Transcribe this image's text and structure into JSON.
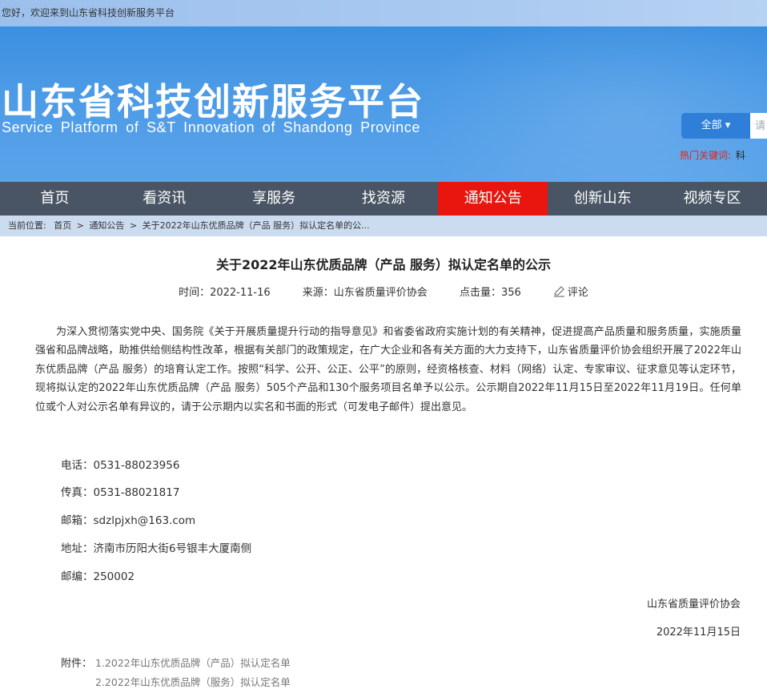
{
  "topbar": {
    "welcome": "您好，欢迎来到山东省科技创新服务平台"
  },
  "header": {
    "title": "山东省科技创新服务平台",
    "subtitle": "Service Platform of S&T Innovation of Shandong Province",
    "search": {
      "category": "全部 ▾",
      "placeholder": "请"
    },
    "hot_keywords": {
      "label": "热门关键词:",
      "first": "科"
    }
  },
  "nav": {
    "items": [
      {
        "label": "首页"
      },
      {
        "label": "看资讯"
      },
      {
        "label": "享服务"
      },
      {
        "label": "找资源"
      },
      {
        "label": "通知公告"
      },
      {
        "label": "创新山东"
      },
      {
        "label": "视频专区"
      }
    ],
    "active": "通知公告"
  },
  "breadcrumb": {
    "prefix": "当前位置:",
    "home": "首页",
    "section": "通知公告",
    "current": "关于2022年山东优质品牌（产品 服务）拟认定名单的公..."
  },
  "article": {
    "title": "关于2022年山东优质品牌（产品 服务）拟认定名单的公示",
    "time": "时间：2022-11-16",
    "source": "来源：山东省质量评价协会",
    "clicks": "点击量：356",
    "comment": "评论",
    "body": "为深入贯彻落实党中央、国务院《关于开展质量提升行动的指导意见》和省委省政府实施计划的有关精神，促进提高产品质量和服务质量，实施质量强省和品牌战略，助推供给侧结构性改革，根据有关部门的政策规定，在广大企业和各有关方面的大力支持下，山东省质量评价协会组织开展了2022年山东优质品牌（产品 服务）的培育认定工作。按照“科学、公开、公正、公平”的原则，经资格核查、材料（网络）认定、专家审议、征求意见等认定环节，现将拟认定的2022年山东优质品牌（产品 服务）505个产品和130个服务项目名单予以公示。公示期自2022年11月15日至2022年11月19日。任何单位或个人对公示名单有异议的，请于公示期内以实名和书面的形式（可发电子邮件）提出意见。",
    "contacts": {
      "phone": "电话：0531-88023956",
      "fax": "传真：0531-88021817",
      "email": "邮箱：sdzlpjxh@163.com",
      "address": "地址：济南市历阳大街6号银丰大厦南侧",
      "postcode": "邮编：250002"
    },
    "signature_org": "山东省质量评价协会",
    "signature_date": "2022年11月15日",
    "attachments": {
      "label": "附件：",
      "items": [
        "1.2022年山东优质品牌（产品）拟认定名单",
        "2.2022年山东优质品牌（服务）拟认定名单"
      ]
    }
  }
}
